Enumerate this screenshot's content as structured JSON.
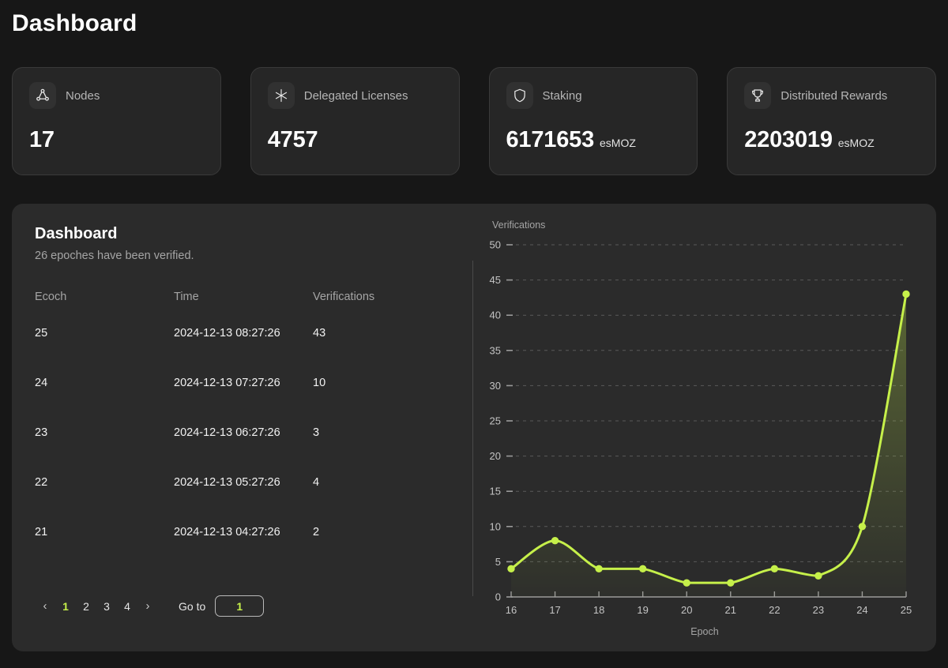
{
  "page": {
    "title": "Dashboard"
  },
  "accent_color": "#c6f04a",
  "stats": [
    {
      "icon": "nodes-network-icon",
      "label": "Nodes",
      "value": "17",
      "unit": ""
    },
    {
      "icon": "asterisk-sparkle-icon",
      "label": "Delegated Licenses",
      "value": "4757",
      "unit": ""
    },
    {
      "icon": "shield-icon",
      "label": "Staking",
      "value": "6171653",
      "unit": "esMOZ"
    },
    {
      "icon": "trophy-icon",
      "label": "Distributed Rewards",
      "value": "2203019",
      "unit": "esMOZ"
    }
  ],
  "panel": {
    "title": "Dashboard",
    "subtitle": "26 epoches have been verified.",
    "table": {
      "headers": [
        "Ecoch",
        "Time",
        "Verifications"
      ],
      "rows": [
        {
          "epoch": "25",
          "time": "2024-12-13 08:27:26",
          "verifications": "43"
        },
        {
          "epoch": "24",
          "time": "2024-12-13 07:27:26",
          "verifications": "10"
        },
        {
          "epoch": "23",
          "time": "2024-12-13 06:27:26",
          "verifications": "3"
        },
        {
          "epoch": "22",
          "time": "2024-12-13 05:27:26",
          "verifications": "4"
        },
        {
          "epoch": "21",
          "time": "2024-12-13 04:27:26",
          "verifications": "2"
        }
      ]
    },
    "pagination": {
      "prev": "‹",
      "next": "›",
      "pages": [
        "1",
        "2",
        "3",
        "4"
      ],
      "active_page": "1",
      "goto_label": "Go to",
      "goto_value": "1"
    }
  },
  "chart_data": {
    "type": "line",
    "title": "",
    "xlabel": "Epoch",
    "ylabel": "Verifications",
    "x": [
      16,
      17,
      18,
      19,
      20,
      21,
      22,
      23,
      24,
      25
    ],
    "xtick_labels": [
      "16",
      "17",
      "18",
      "19",
      "20",
      "21",
      "22",
      "23",
      "24",
      "25"
    ],
    "values": [
      4,
      8,
      4,
      4,
      2,
      2,
      4,
      3,
      10,
      43
    ],
    "ytick_labels": [
      "0",
      "5",
      "10",
      "15",
      "20",
      "25",
      "30",
      "35",
      "40",
      "45",
      "50"
    ],
    "yticks": [
      0,
      5,
      10,
      15,
      20,
      25,
      30,
      35,
      40,
      45,
      50
    ],
    "ylim": [
      0,
      50
    ],
    "xlim": [
      16,
      25
    ],
    "grid": true,
    "legend": "none",
    "line_color": "#c6f04a",
    "marker": "circle",
    "area_fill": true,
    "smooth": true
  }
}
